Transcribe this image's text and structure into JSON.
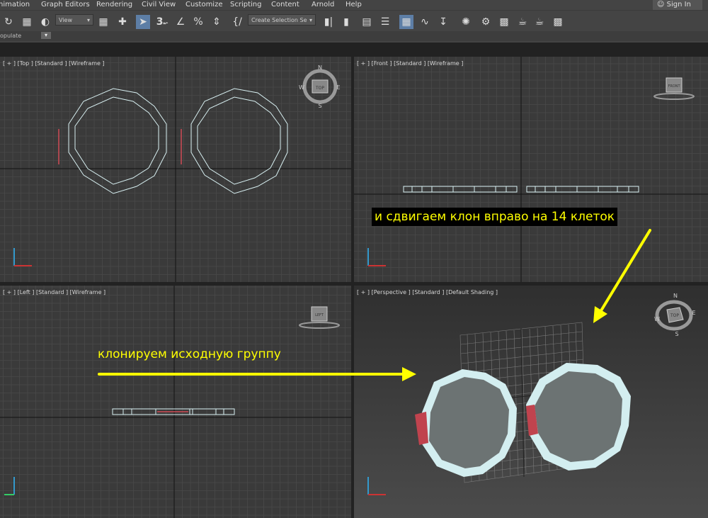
{
  "menu": {
    "items": [
      "nimation",
      "Graph Editors",
      "Rendering",
      "Civil View",
      "Customize",
      "Scripting",
      "Content",
      "Arnold",
      "Help"
    ],
    "sign_in": "Sign In"
  },
  "toolbar": {
    "view_dropdown": "View",
    "selection_set_dropdown": "Create Selection Se",
    "snap_value": "3"
  },
  "ribbon": {
    "label": "opulate"
  },
  "viewports": {
    "top": {
      "label": "[ + ] [Top ] [Standard ] [Wireframe ]",
      "compass": {
        "n": "N",
        "s": "S",
        "w": "W",
        "e": "E",
        "cube": "TOP"
      }
    },
    "front": {
      "label": "[ + ] [Front ] [Standard ] [Wireframe ]",
      "cube": "FRONT"
    },
    "left": {
      "label": "[ + ] [Left ] [Standard ] [Wireframe ]",
      "cube": "LEFT"
    },
    "perspective": {
      "label": "[ + ] [Perspective ] [Standard ] [Default Shading ]",
      "compass": {
        "n": "N",
        "s": "S",
        "w": "W",
        "e": "E",
        "cube": "TOP"
      }
    }
  },
  "annotations": {
    "clone": "клонируем исходную группу",
    "move": "и сдвигаем клон вправо на 14 клеток"
  },
  "colors": {
    "grid": "#4a4a4a",
    "viewport_bg": "#3a3a3a",
    "wire": "#d8f0f2",
    "ring": "#d3eef0",
    "red": "#d04a55",
    "yellow": "#ffff00",
    "active_border": "#c8b866"
  }
}
